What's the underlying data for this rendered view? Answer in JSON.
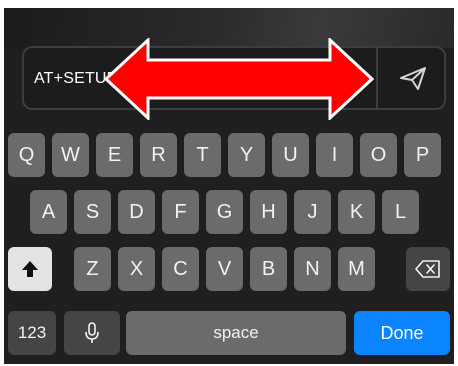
{
  "input": {
    "value": "AT+SETUP"
  },
  "icons": {
    "send": "paper-plane-icon",
    "shift": "shift-arrow-icon",
    "backspace": "backspace-icon",
    "mic": "microphone-icon"
  },
  "keyboard": {
    "row1": [
      "Q",
      "W",
      "E",
      "R",
      "T",
      "Y",
      "U",
      "I",
      "O",
      "P"
    ],
    "row2": [
      "A",
      "S",
      "D",
      "F",
      "G",
      "H",
      "J",
      "K",
      "L"
    ],
    "row3": [
      "Z",
      "X",
      "C",
      "V",
      "B",
      "N",
      "M"
    ],
    "numbers_label": "123",
    "space_label": "space",
    "done_label": "Done"
  },
  "colors": {
    "keyboard_bg": "#1f1f21",
    "letter_key": "#6b6b6d",
    "function_key": "#454547",
    "done_key": "#0a84ff",
    "annotation_arrow": "#ff0000"
  }
}
